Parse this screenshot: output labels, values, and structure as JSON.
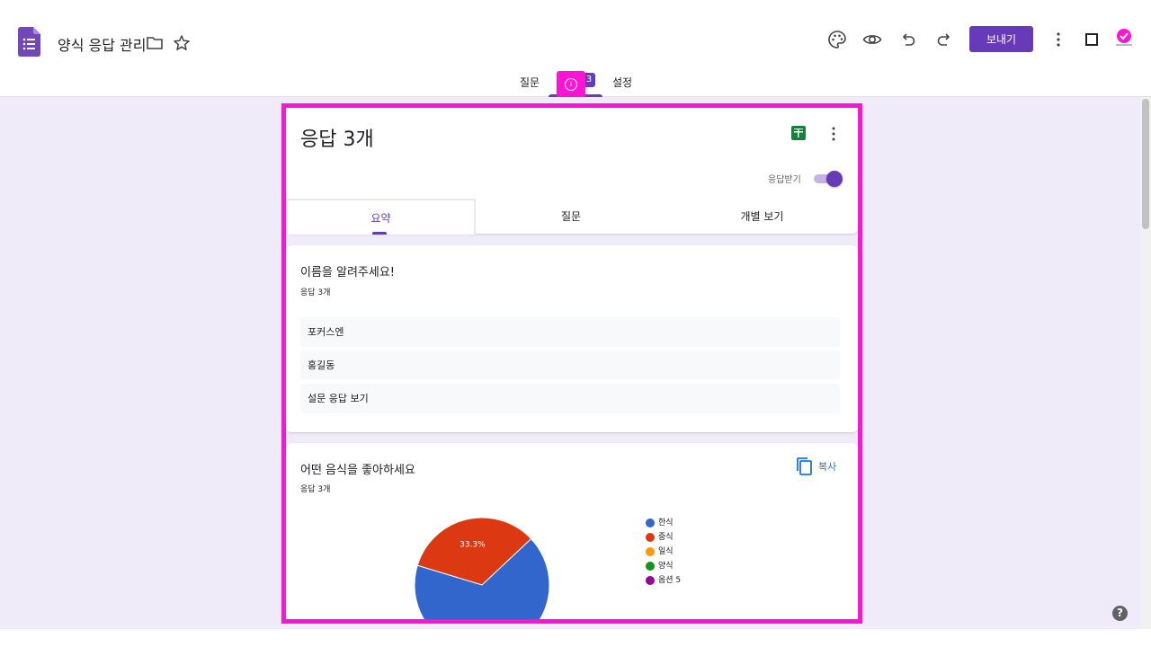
{
  "header": {
    "doc_title": "양식 응답 관리",
    "send_label": "보내기",
    "avatar_text": "✓"
  },
  "top_tabs": {
    "questions": "질문",
    "responses_count": "3",
    "settings": "설정"
  },
  "marker": {
    "text": "i"
  },
  "summary": {
    "title": "응답 3개",
    "accepting_label": "응답받기",
    "accepting": true,
    "tabs": [
      "요약",
      "질문",
      "개별 보기"
    ]
  },
  "question1": {
    "title": "이름을 알려주세요!",
    "count": "응답 3개",
    "answers": [
      "포커스엔",
      "홍길동",
      "설문 응답 보기"
    ]
  },
  "question2": {
    "title": "어떤 음식을 좋아하세요",
    "count": "응답 3개",
    "copy_label": "복사"
  },
  "chart_data": {
    "type": "pie",
    "categories": [
      "한식",
      "중식",
      "일식",
      "양식",
      "옵션 5"
    ],
    "values": [
      66.7,
      33.3,
      0,
      0,
      0
    ],
    "colors": [
      "#3366cc",
      "#dc3912",
      "#ff9900",
      "#109618",
      "#990099"
    ],
    "data_labels": [
      "",
      "33.3%",
      "",
      "",
      ""
    ]
  },
  "help": {
    "label": "?"
  },
  "colors": {
    "accent": "#673ab7",
    "highlight": "#ff14d6",
    "background": "#f0ebf8"
  }
}
